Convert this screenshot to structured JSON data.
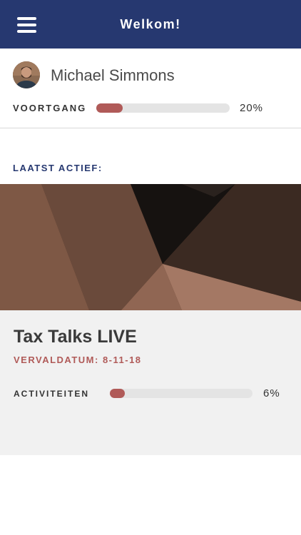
{
  "header": {
    "title": "Welkom!",
    "menu_icon": "hamburger-menu-icon"
  },
  "profile": {
    "name": "Michael Simmons",
    "progress_label": "VOORTGANG",
    "progress_value_text": "20%",
    "progress": 0.2
  },
  "recent": {
    "section_label": "LAATST ACTIEF:",
    "course": {
      "title": "Tax Talks LIVE",
      "due_date": "VERVALDATUM: 8-11-18",
      "activities_label": "ACTIVITEITEN",
      "activities_value_text": "6%",
      "activities_progress": 0.06
    }
  },
  "colors": {
    "header_bg": "#263870",
    "accent": "#b05a58",
    "section_label": "#263870",
    "track": "#e4e4e4",
    "card_bg": "#f1f1f1"
  }
}
